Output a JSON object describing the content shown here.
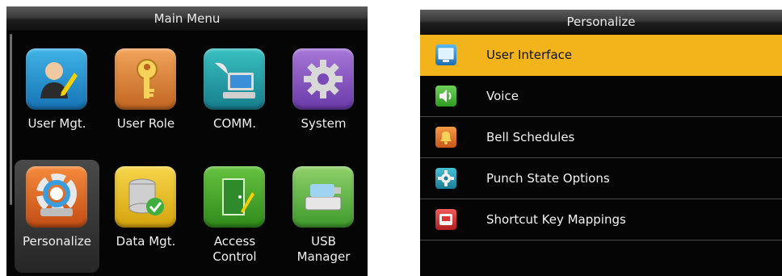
{
  "main_menu": {
    "title": "Main Menu",
    "items": [
      {
        "label": "User Mgt.",
        "icon": "user-edit-icon"
      },
      {
        "label": "User Role",
        "icon": "key-icon"
      },
      {
        "label": "COMM.",
        "icon": "computer-satellite-icon"
      },
      {
        "label": "System",
        "icon": "gear-icon"
      },
      {
        "label": "Personalize",
        "icon": "color-wheel-icon",
        "selected": true
      },
      {
        "label": "Data Mgt.",
        "icon": "database-check-icon"
      },
      {
        "label": "Access Control",
        "label_lines": [
          "Access",
          "Control"
        ],
        "icon": "door-icon"
      },
      {
        "label": "USB Manager",
        "label_lines": [
          "USB",
          "Manager"
        ],
        "icon": "usb-drive-icon"
      }
    ]
  },
  "personalize": {
    "title": "Personalize",
    "items": [
      {
        "label": "User Interface",
        "icon": "monitor-icon",
        "selected": true
      },
      {
        "label": "Voice",
        "icon": "speaker-icon"
      },
      {
        "label": "Bell Schedules",
        "icon": "bell-icon"
      },
      {
        "label": "Punch State Options",
        "icon": "gear-settings-icon"
      },
      {
        "label": "Shortcut Key Mappings",
        "icon": "keyboard-key-icon"
      }
    ]
  },
  "colors": {
    "highlight": "#f3b41b",
    "background": "#050505",
    "text": "#f2f2f2"
  }
}
